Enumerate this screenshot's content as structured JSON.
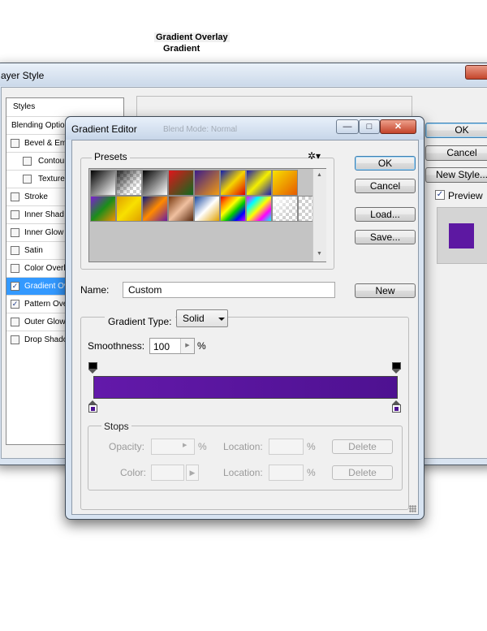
{
  "layer_style": {
    "title": "ayer Style",
    "styles_header": "Styles",
    "blending_options": "Blending Optio",
    "items": [
      {
        "label": "Bevel & Emb",
        "checked": false,
        "sub": false
      },
      {
        "label": "Contour",
        "checked": false,
        "sub": true
      },
      {
        "label": "Texture",
        "checked": false,
        "sub": true
      },
      {
        "label": "Stroke",
        "checked": false,
        "sub": false
      },
      {
        "label": "Inner Shad",
        "checked": false,
        "sub": false
      },
      {
        "label": "Inner Glow",
        "checked": false,
        "sub": false
      },
      {
        "label": "Satin",
        "checked": false,
        "sub": false
      },
      {
        "label": "Color Overla",
        "checked": false,
        "sub": false
      },
      {
        "label": "Gradient Ov",
        "checked": true,
        "sub": false,
        "selected": true
      },
      {
        "label": "Pattern Ove",
        "checked": true,
        "sub": false
      },
      {
        "label": "Outer Glow",
        "checked": false,
        "sub": false
      },
      {
        "label": "Drop Shado",
        "checked": false,
        "sub": false
      }
    ],
    "group_title": "Gradient Overlay",
    "group_sub": "Gradient",
    "ok_label": "OK",
    "cancel_label": "Cancel",
    "new_style_label": "New Style...",
    "preview_label": "Preview",
    "preview_checked": true,
    "preview_color": "#5d18a2",
    "close_glyph": "×"
  },
  "gradient_editor": {
    "title": "Gradient Editor",
    "ghost_text": "Blend Mode: Normal",
    "window_buttons": {
      "minimize": "—",
      "maximize": "□",
      "close": "✕"
    },
    "presets_label": "Presets",
    "gear_glyph": "✲▾",
    "presets": [
      [
        "linear-gradient(135deg,#000,#fff)",
        "checker-black-fade",
        "linear-gradient(135deg,#000,#fff)",
        "linear-gradient(135deg,#e0151b,#0e6b1e)",
        "linear-gradient(135deg,#3b1b8a,#f39c12)",
        "linear-gradient(135deg,#0d1ab0,#f5d500,#d00)",
        "linear-gradient(135deg,#1a1ab0,#f5ef00,#1a1ab0)",
        "linear-gradient(135deg,#f7e100,#e65b00)"
      ],
      [
        "linear-gradient(135deg,#7d1bd6,#1b8d1b,#f09000)",
        "linear-gradient(135deg,#e0a000,#f8e000,#e0a000)",
        "linear-gradient(135deg,#0a1a80,#ff8a00,#6a1aa0)",
        "linear-gradient(135deg,#7a3a10,#f0c0a0,#5a2a10)",
        "linear-gradient(135deg,#1a4aa0,#fff,#e0a000)",
        "linear-gradient(135deg,#e00,#f80,#ff0,#0c0,#00f,#c0f)",
        "linear-gradient(135deg,#f0f,#0ff,#ff0,#f0f,#0ff)",
        "checker-white-fade",
        "checker"
      ]
    ],
    "ok_label": "OK",
    "cancel_label": "Cancel",
    "load_label": "Load...",
    "save_label": "Save...",
    "name_label": "Name:",
    "name_value": "Custom",
    "new_label": "New",
    "gradient_type_label": "Gradient Type:",
    "gradient_type_value": "Solid",
    "smoothness_label": "Smoothness:",
    "smoothness_value": "100",
    "smoothness_unit": "%",
    "gradient_start_color": "#6319aa",
    "gradient_end_color": "#4e1191",
    "stops_label": "Stops",
    "opacity_label": "Opacity:",
    "opacity_unit": "%",
    "location_label": "Location:",
    "location_unit": "%",
    "color_label": "Color:",
    "delete_label": "Delete"
  }
}
